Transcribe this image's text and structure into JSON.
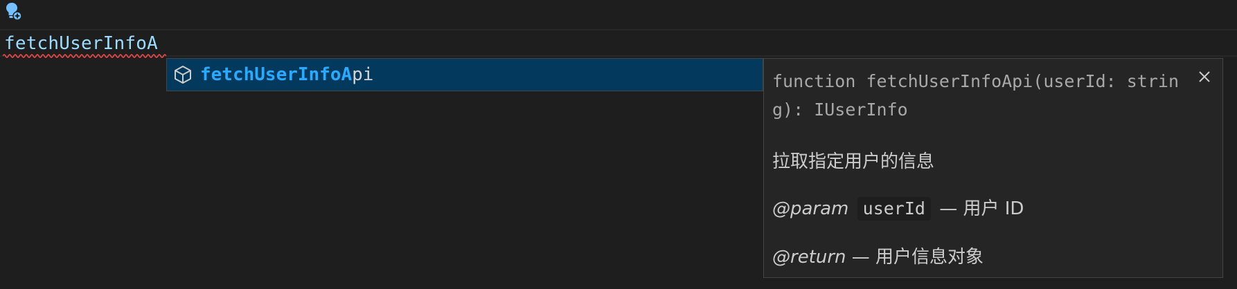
{
  "editor": {
    "lightbulb_icon": "lightbulb-autofix-icon",
    "line_text": "fetchUserInfoA",
    "error_squiggle_color": "#f14c4c",
    "text_color": "#9cdcfe"
  },
  "suggest": {
    "item_icon": "module-cube-icon",
    "match_text": "fetchUserInfoA",
    "rest_text": "pi",
    "selected_bg": "#04395e",
    "match_color": "#2aaaff"
  },
  "details": {
    "close_icon": "close-icon",
    "signature": "function fetchUserInfoApi(userId: string): IUserInfo",
    "description": "拉取指定用户的信息",
    "param_tag": "@param",
    "param_name": "userId",
    "param_desc": " — 用户 ID",
    "return_tag": "@return",
    "return_desc": " — 用户信息对象"
  }
}
